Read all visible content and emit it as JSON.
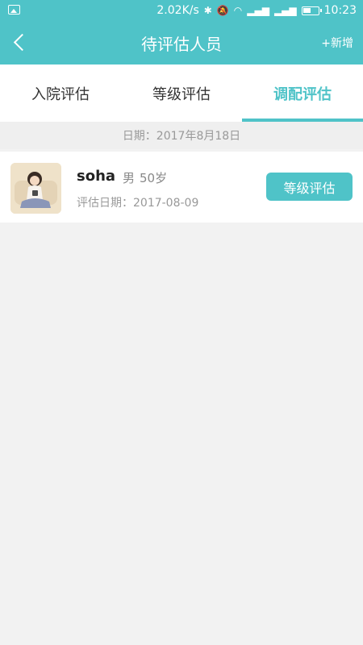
{
  "status_bar": {
    "speed": "2.02K/s",
    "time": "10:23",
    "icons": [
      "image-icon",
      "bluetooth-icon",
      "mute-icon",
      "wifi-icon",
      "signal-icon",
      "signal-icon",
      "battery-icon"
    ]
  },
  "header": {
    "title": "待评估人员",
    "add_label": "+新增"
  },
  "tabs": [
    {
      "label": "入院评估",
      "active": false
    },
    {
      "label": "等级评估",
      "active": false
    },
    {
      "label": "调配评估",
      "active": true
    }
  ],
  "date_label": "日期：2017年8月18日",
  "people": [
    {
      "name": "soha",
      "gender": "男",
      "age": "50岁",
      "eval_date": "评估日期：2017-08-09",
      "action": "等级评估"
    }
  ],
  "colors": {
    "accent": "#4fc3c8",
    "background": "#f2f2f2"
  }
}
